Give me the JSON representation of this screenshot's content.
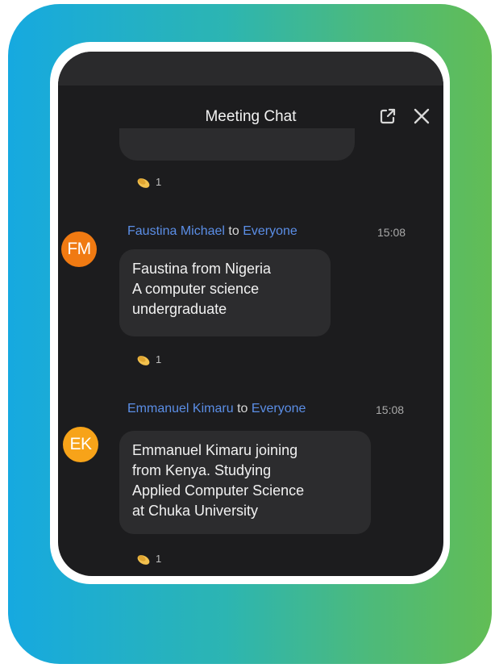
{
  "chat": {
    "title": "Meeting Chat",
    "reaction_count": "1",
    "messages": [
      {
        "sender": "Faustina Michael",
        "connector": "to",
        "recipient": "Everyone",
        "time": "15:08",
        "initials": "FM",
        "avatar_color": "#F07A12",
        "lines": [
          "Faustina from Nigeria",
          "A computer science",
          "undergraduate"
        ],
        "reaction_count": "1"
      },
      {
        "sender": "Emmanuel Kimaru",
        "connector": "to",
        "recipient": "Everyone",
        "time": "15:08",
        "initials": "EK",
        "avatar_color": "#F7A319",
        "lines": [
          "Emmanuel Kimaru joining",
          "from Kenya. Studying",
          "Applied Computer Science",
          "at Chuka University"
        ],
        "reaction_count": "1"
      }
    ]
  },
  "icons": {
    "reaction": "clapping-hands-icon",
    "popout": "pop-out-icon",
    "close": "close-icon"
  },
  "colors": {
    "gradient_start": "#16A9E0",
    "gradient_end": "#62BD55",
    "window_bg": "#1C1C1E",
    "bubble_bg": "#2C2C2E",
    "name_link": "#5B8EE6"
  }
}
